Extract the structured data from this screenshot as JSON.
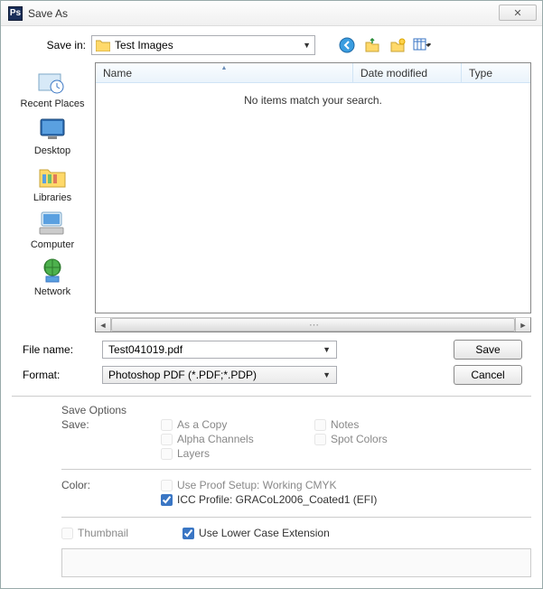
{
  "titlebar": {
    "app_icon": "Ps",
    "title": "Save As",
    "close_glyph": "✕"
  },
  "savein": {
    "label": "Save in:",
    "folder": "Test Images"
  },
  "places": [
    {
      "label": "Recent Places"
    },
    {
      "label": "Desktop"
    },
    {
      "label": "Libraries"
    },
    {
      "label": "Computer"
    },
    {
      "label": "Network"
    }
  ],
  "listview": {
    "cols": {
      "name": "Name",
      "date": "Date modified",
      "type": "Type"
    },
    "empty_msg": "No items match your search."
  },
  "filename": {
    "label": "File name:",
    "value": "Test041019.pdf"
  },
  "format": {
    "label": "Format:",
    "value": "Photoshop PDF (*.PDF;*.PDP)"
  },
  "buttons": {
    "save": "Save",
    "cancel": "Cancel"
  },
  "options": {
    "header": "Save Options",
    "save_label": "Save:",
    "as_copy": "As a Copy",
    "notes": "Notes",
    "alpha": "Alpha Channels",
    "spot": "Spot Colors",
    "layers": "Layers",
    "color_label": "Color:",
    "proof": "Use Proof Setup:  Working CMYK",
    "icc": "ICC Profile:  GRACoL2006_Coated1 (EFI)",
    "thumbnail": "Thumbnail",
    "lowercase": "Use Lower Case Extension"
  }
}
